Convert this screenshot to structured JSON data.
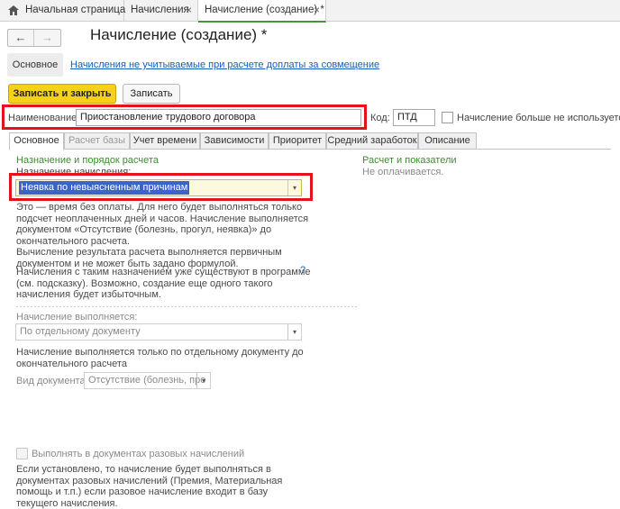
{
  "tabs": {
    "home": "Начальная страница",
    "accruals": "Начисления",
    "create": "Начисление (создание) *",
    "close": "×"
  },
  "nav": {
    "back": "←",
    "forward": "→"
  },
  "form_title": "Начисление (создание) *",
  "section_tab": "Основное",
  "hint_link": "Начисления не учитываемые при расчете доплаты за совмещение",
  "buttons": {
    "save_close": "Записать и закрыть",
    "save": "Записать"
  },
  "name": {
    "label": "Наименование:",
    "value": "Приостановление трудового договора"
  },
  "code": {
    "label": "Код:",
    "value": "ПТД"
  },
  "not_used": {
    "label": "Начисление больше не используется",
    "checked": false
  },
  "form_tabs": [
    "Основное",
    "Расчет базы",
    "Учет времени",
    "Зависимости",
    "Приоритет",
    "Средний заработок",
    "Описание"
  ],
  "left": {
    "group_title": "Назначение и порядок расчета",
    "purpose_label": "Назначение начисления:",
    "purpose_value": "Неявка по невыясненным причинам",
    "desc1": "Это — время без оплаты. Для него будет выполняться только",
    "desc2": "подсчет неоплаченных дней и часов. Начисление выполняется",
    "desc3": "документом «Отсутствие (болезнь, прогул, неявка)» до",
    "desc4": "окончательного расчета.",
    "desc5": "Вычисление результата расчета выполняется первичным",
    "desc6": "документом и не может быть задано формулой.",
    "warn1": "Начисления с таким назначением уже существуют в программе",
    "warn2": "(см. подсказку). Возможно, создание еще одного такого",
    "warn3": "начисления будет избыточным.",
    "help": "?",
    "exec_label": "Начисление выполняется:",
    "exec_value": "По отдельному документу",
    "exec_note1": "Начисление выполняется только по отдельному документу до",
    "exec_note2": "окончательного расчета",
    "doc_label": "Вид документа:",
    "doc_value": "Отсутствие (болезнь, про",
    "onetime_label": "Выполнять в документах разовых начислений",
    "onetime_checked": false,
    "note1": "Если установлено, то начисление будет выполняться в",
    "note2": "документах разовых начислений (Премия, Материальная",
    "note3": "помощь и т.п.) если разовое начисление входит в базу",
    "note4": "текущего начисления."
  },
  "right": {
    "group_title": "Расчет и показатели",
    "value": "Не оплачивается."
  },
  "colors": {
    "accent_yellow": "#f6d11a",
    "highlight_red": "#e3121b",
    "group_green": "#3c8c2f",
    "link_blue": "#1a5cb8"
  }
}
